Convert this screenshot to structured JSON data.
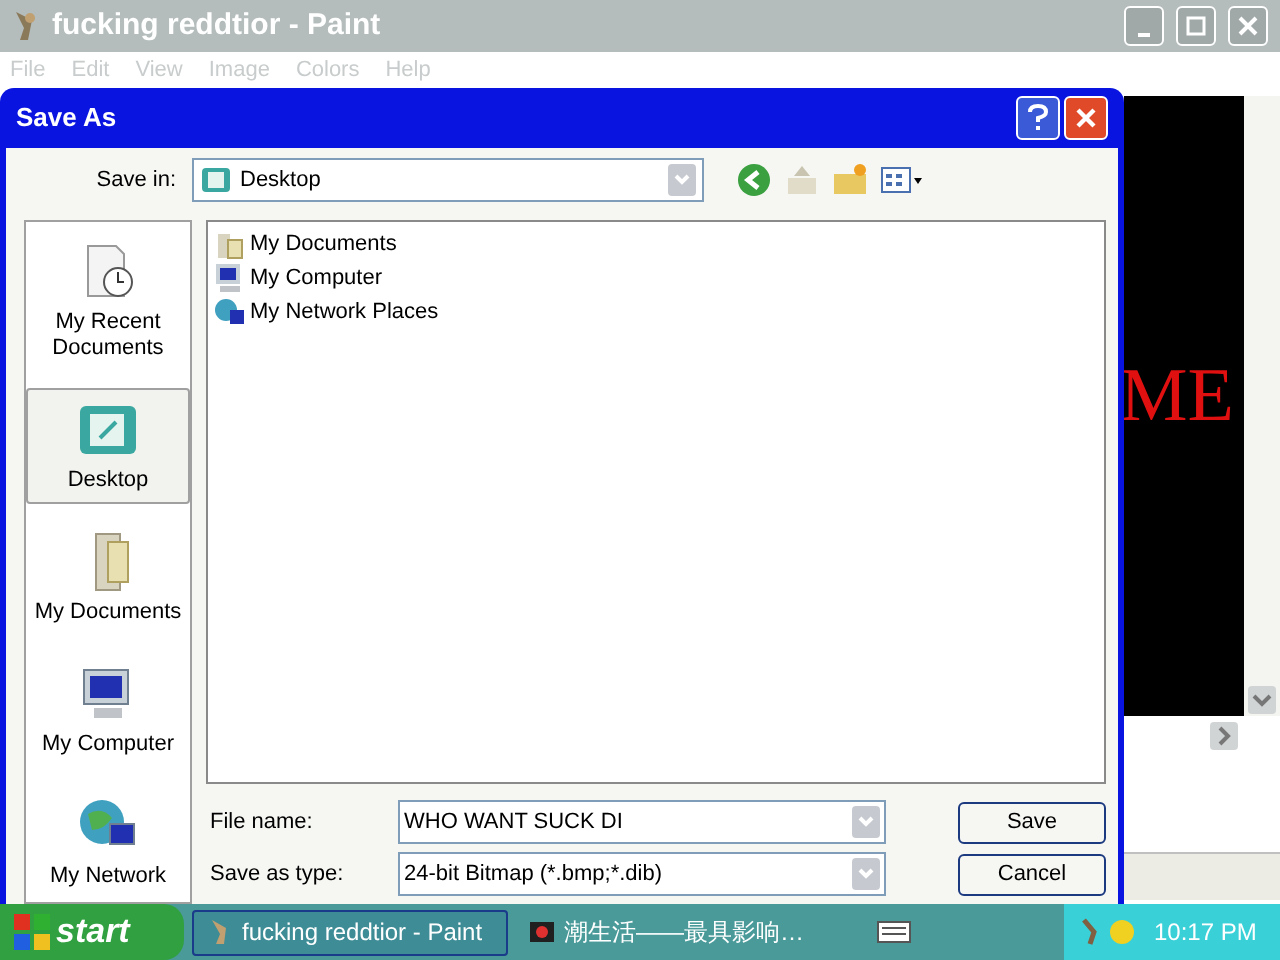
{
  "paint_window": {
    "title": "fucking reddtior - Paint",
    "menu": [
      {
        "label": "File",
        "disabled": true
      },
      {
        "label": "Edit",
        "disabled": true
      },
      {
        "label": "View",
        "disabled": true
      },
      {
        "label": "Image",
        "disabled": true
      },
      {
        "label": "Colors",
        "disabled": true
      },
      {
        "label": "Help",
        "disabled": true
      }
    ],
    "canvas_text": "ME"
  },
  "dialog": {
    "title": "Save As",
    "save_in": {
      "label": "Save in:",
      "value": "Desktop"
    },
    "places": [
      {
        "label": "My Recent Documents",
        "selected": false
      },
      {
        "label": "Desktop",
        "selected": true
      },
      {
        "label": "My Documents",
        "selected": false
      },
      {
        "label": "My Computer",
        "selected": false
      },
      {
        "label": "My Network",
        "selected": false
      }
    ],
    "files": [
      "My Documents",
      "My Computer",
      "My Network Places"
    ],
    "file_name": {
      "label": "File name:",
      "value": "WHO WANT SUCK DI"
    },
    "save_as_type": {
      "label": "Save as type:",
      "value": "24-bit Bitmap (*.bmp;*.dib)"
    },
    "buttons": [
      "Save",
      "Cancel"
    ]
  },
  "taskbar": {
    "start": "start",
    "tasks": [
      {
        "label": "fucking reddtior - Paint",
        "selected": true
      },
      {
        "label": "潮生活——最具影响…",
        "selected": false
      }
    ],
    "clock": "10:17 PM"
  }
}
